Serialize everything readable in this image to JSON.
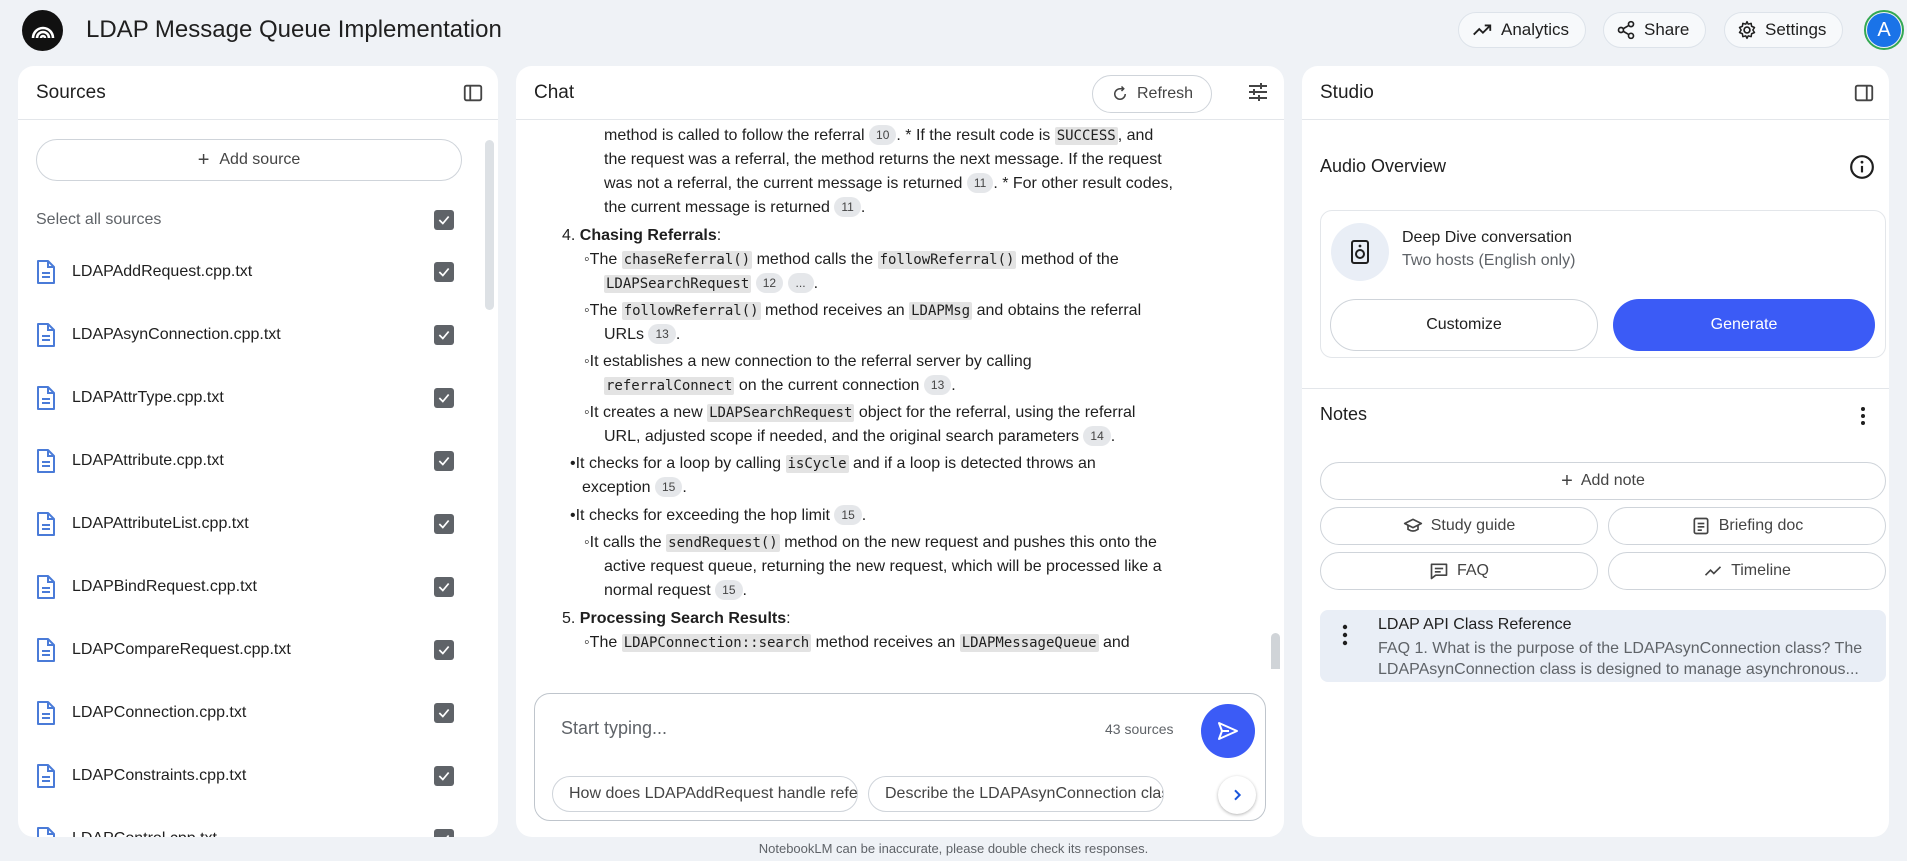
{
  "app": {
    "title": "LDAP Message Queue Implementation",
    "avatar_letter": "A"
  },
  "top_actions": {
    "analytics": "Analytics",
    "share": "Share",
    "settings": "Settings"
  },
  "sources": {
    "title": "Sources",
    "add_label": "Add source",
    "select_all": "Select all sources",
    "items": [
      "LDAPAddRequest.cpp.txt",
      "LDAPAsynConnection.cpp.txt",
      "LDAPAttrType.cpp.txt",
      "LDAPAttribute.cpp.txt",
      "LDAPAttributeList.cpp.txt",
      "LDAPBindRequest.cpp.txt",
      "LDAPCompareRequest.cpp.txt",
      "LDAPConnection.cpp.txt",
      "LDAPConstraints.cpp.txt",
      "LDAPControl.cpp.txt"
    ]
  },
  "chat": {
    "title": "Chat",
    "refresh": "Refresh",
    "lines": {
      "l1a": "method is called to follow the referral",
      "c10": "10",
      "l1b": ". * If the result code is",
      "k_success": "SUCCESS",
      "l1c": ", and",
      "l2": "the request was a referral, the method returns the next message. If the request",
      "l3a": "was not a referral, the current message is returned",
      "c11": "11",
      "l3b": ". * For other result codes,",
      "l4a": "the current message is returned",
      "l4b": ".",
      "h4num": "4.",
      "h4": "Chasing Referrals",
      "colon": ":",
      "the": "The",
      "k_chase": "chaseReferral()",
      "t_calls": "method calls the",
      "k_follow": "followReferral()",
      "t_method_of": "method of the",
      "k_search": "LDAPSearchRequest",
      "c12": "12",
      "c_more": "...",
      "dot": ".",
      "t_receives": "method receives an",
      "k_msg": "LDAPMsg",
      "t_obtains": "and obtains the referral",
      "t_urls": "URLs",
      "c13": "13",
      "t_establishes": "It establishes a new connection to the referral server by calling",
      "k_refconn": "referralConnect",
      "t_current_conn": "on the current connection",
      "t_creates": "It creates a new",
      "t_object_for": "object for the referral, using the referral",
      "t_url_adjusted": "URL, adjusted scope if needed, and the original search parameters",
      "c14": "14",
      "t_loop": "It checks for a loop by calling",
      "k_cycle": "isCycle",
      "t_if_loop": "and if a loop is detected throws an",
      "t_exception": "exception",
      "c15": "15",
      "t_hop": "It checks for exceeding the hop limit",
      "t_it_calls": "It calls the",
      "k_send": "sendRequest()",
      "t_pushes": "method on the new request and pushes this onto the",
      "t_active": "active request queue, returning the new request, which will be processed like a",
      "t_normal": "normal request",
      "h5num": "5.",
      "h5": "Processing Search Results",
      "k_connsearch": "LDAPConnection::search",
      "t_recv2": "method receives an",
      "k_mq": "LDAPMessageQueue",
      "t_and": "and"
    },
    "composer_placeholder": "Start typing...",
    "source_count": "43 sources",
    "suggestions": [
      "How does LDAPAddRequest handle referrals?",
      "Describe the LDAPAsynConnection class."
    ],
    "disclaimer": "NotebookLM can be inaccurate, please double check its responses."
  },
  "studio": {
    "title": "Studio",
    "audio_title": "Audio Overview",
    "audio_name": "Deep Dive conversation",
    "audio_sub": "Two hosts (English only)",
    "customize": "Customize",
    "generate": "Generate",
    "notes_title": "Notes",
    "add_note": "Add note",
    "study_guide": "Study guide",
    "briefing_doc": "Briefing doc",
    "faq": "FAQ",
    "timeline": "Timeline",
    "note": {
      "title": "LDAP API Class Reference",
      "snippet": "FAQ 1. What is the purpose of the LDAPAsynConnection class? The LDAPAsynConnection class is designed to manage asynchronous..."
    }
  },
  "colors": {
    "accent": "#3b5bf6",
    "page_bg": "#eff2f6",
    "code_bg": "#e3e3e3"
  }
}
